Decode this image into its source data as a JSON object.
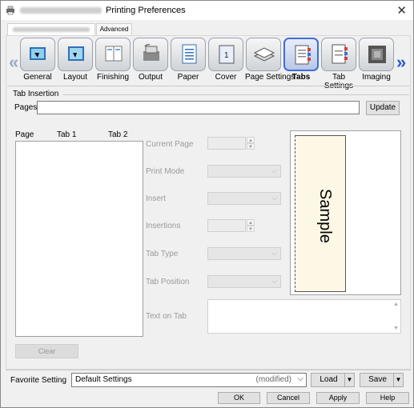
{
  "window": {
    "title": "Printing Preferences"
  },
  "tabs": {
    "advanced": "Advanced"
  },
  "categories": [
    {
      "label": "General"
    },
    {
      "label": "Layout"
    },
    {
      "label": "Finishing"
    },
    {
      "label": "Output"
    },
    {
      "label": "Paper"
    },
    {
      "label": "Cover"
    },
    {
      "label": "Page Settings"
    },
    {
      "label": "Tabs"
    },
    {
      "label": "Tab Settings"
    },
    {
      "label": "Imaging"
    }
  ],
  "tab_insertion": {
    "group_label": "Tab Insertion",
    "pages_label": "Pages",
    "pages_value": "",
    "update_button": "Update",
    "list_headers": {
      "page": "Page",
      "tab1": "Tab 1",
      "tab2": "Tab 2"
    },
    "clear_button": "Clear",
    "current_page_label": "Current Page",
    "print_mode_label": "Print Mode",
    "insert_label": "Insert",
    "insertions_label": "Insertions",
    "tab_type_label": "Tab Type",
    "tab_position_label": "Tab Position",
    "text_on_tab_label": "Text on Tab",
    "preview_text": "Sample"
  },
  "favorite": {
    "label": "Favorite Setting",
    "value": "Default Settings",
    "modified": "(modified)",
    "load_button": "Load",
    "save_button": "Save"
  },
  "footer": {
    "ok": "OK",
    "cancel": "Cancel",
    "apply": "Apply",
    "help": "Help"
  }
}
